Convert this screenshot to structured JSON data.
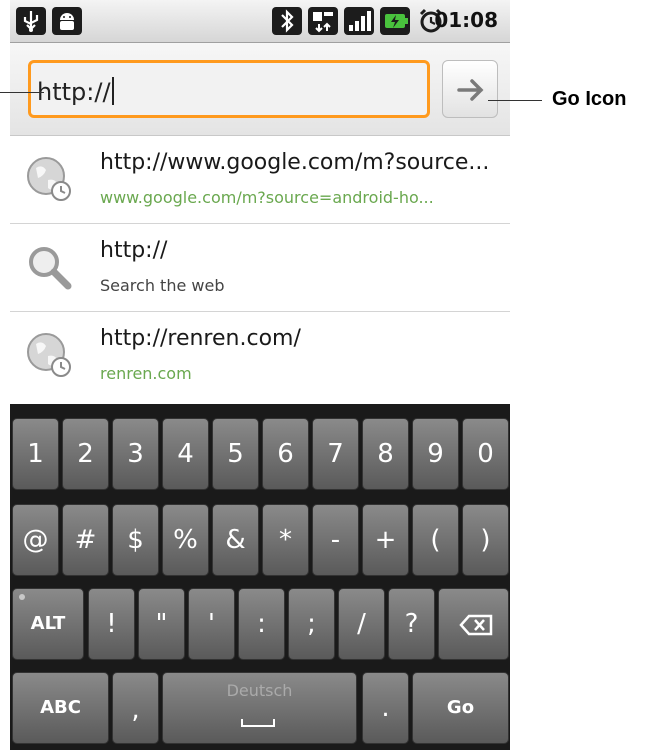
{
  "status_bar": {
    "time": "01:08",
    "icons": [
      "usb-icon",
      "android-debug-icon",
      "bluetooth-icon",
      "data-transfer-icon",
      "signal-bars-icon",
      "battery-charging-icon",
      "alarm-icon"
    ]
  },
  "url_bar": {
    "value": "http://",
    "go_icon": "arrow-right-icon",
    "focus_color": "#ff9a1e"
  },
  "suggestions": [
    {
      "icon": "globe-history-icon",
      "title": "http://www.google.com/m?source...",
      "subtitle": "www.google.com/m?source=android-ho...",
      "subtitle_kind": "url"
    },
    {
      "icon": "search-icon",
      "title": "http://",
      "subtitle": "Search the web",
      "subtitle_kind": "plain"
    },
    {
      "icon": "globe-history-icon",
      "title": "http://renren.com/",
      "subtitle": "renren.com",
      "subtitle_kind": "url"
    }
  ],
  "keyboard": {
    "row1": [
      "1",
      "2",
      "3",
      "4",
      "5",
      "6",
      "7",
      "8",
      "9",
      "0"
    ],
    "row2": [
      "@",
      "#",
      "$",
      "%",
      "&",
      "*",
      "-",
      "+",
      "(",
      ")"
    ],
    "row3": {
      "alt": "ALT",
      "keys": [
        "!",
        "\"",
        "'",
        ":",
        ";",
        "/",
        "?"
      ],
      "delete_icon": "backspace-icon"
    },
    "row4": {
      "abc": "ABC",
      "comma": ",",
      "space_language": "Deutsch",
      "period": ".",
      "go": "Go"
    }
  },
  "annotations": {
    "go_icon_label": "Go Icon"
  },
  "colors": {
    "link_green": "#6aa84f",
    "keyboard_bg": "#1a1a1a"
  }
}
